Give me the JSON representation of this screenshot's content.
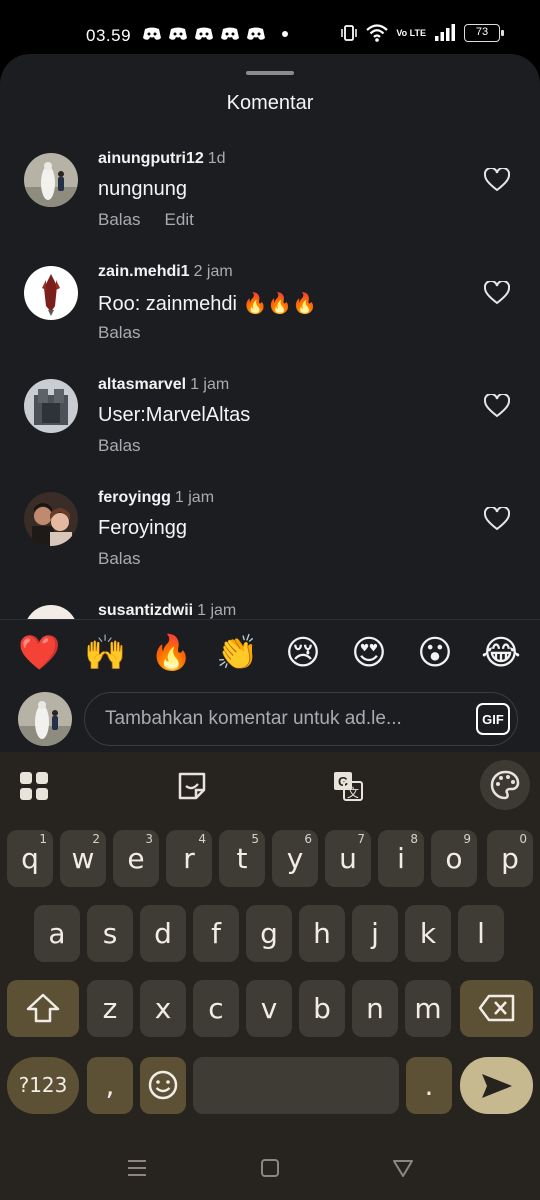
{
  "status_bar": {
    "time": "03.59",
    "battery": "73",
    "network": "Vo LTE"
  },
  "sheet": {
    "title": "Komentar"
  },
  "comments": [
    {
      "username": "ainungputri12",
      "time": "1d",
      "text": "nungnung",
      "actions": [
        "Balas",
        "Edit"
      ]
    },
    {
      "username": "zain.mehdi1",
      "time": "2 jam",
      "text": "Roo: zainmehdi 🔥🔥🔥",
      "actions": [
        "Balas"
      ]
    },
    {
      "username": "altasmarvel",
      "time": "1 jam",
      "text": "User:MarvelAltas",
      "actions": [
        "Balas"
      ]
    },
    {
      "username": "feroyingg",
      "time": "1 jam",
      "text": "Feroyingg",
      "actions": [
        "Balas"
      ]
    },
    {
      "username": "susantizdwii",
      "time": "1 jam",
      "text": "",
      "actions": []
    }
  ],
  "quick_reactions": [
    "❤️",
    "🙌",
    "🔥",
    "👏",
    "😢",
    "😍",
    "😮",
    "😂"
  ],
  "composer": {
    "placeholder": "Tambahkan komentar untuk ad.le...",
    "gif_label": "GIF"
  },
  "keyboard": {
    "row1": [
      {
        "key": "q",
        "hint": "1"
      },
      {
        "key": "w",
        "hint": "2"
      },
      {
        "key": "e",
        "hint": "3"
      },
      {
        "key": "r",
        "hint": "4"
      },
      {
        "key": "t",
        "hint": "5"
      },
      {
        "key": "y",
        "hint": "6"
      },
      {
        "key": "u",
        "hint": "7"
      },
      {
        "key": "i",
        "hint": "8"
      },
      {
        "key": "o",
        "hint": "9"
      },
      {
        "key": "p",
        "hint": "0"
      }
    ],
    "row2": [
      "a",
      "s",
      "d",
      "f",
      "g",
      "h",
      "j",
      "k",
      "l"
    ],
    "row3": [
      "z",
      "x",
      "c",
      "v",
      "b",
      "n",
      "m"
    ],
    "symbols_key": "?123",
    "comma_key": ",",
    "period_key": "."
  },
  "colors": {
    "sheet_bg": "#1b1d21",
    "keyboard_bg": "#27241f",
    "key_bg": "#3f3b35",
    "modifier_key_bg": "#5c5035",
    "muted_text": "#a9abb0"
  }
}
